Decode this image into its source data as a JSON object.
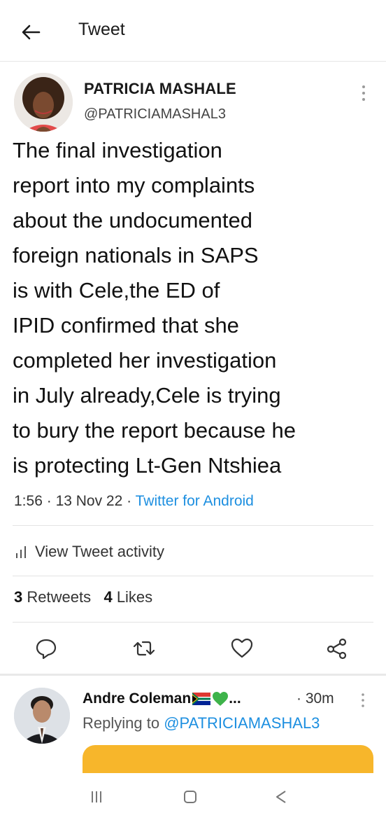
{
  "header": {
    "title": "Tweet",
    "back_icon": "arrow-left-icon"
  },
  "tweet": {
    "author_name": "PATRICIA MASHALE",
    "author_handle": "@PATRICIAMASHAL3",
    "lines": [
      "The final investigation",
      "report into my complaints",
      "about the undocumented",
      "foreign nationals in SAPS",
      "is with Cele,the ED of",
      "IPID confirmed that she",
      "completed her investigation",
      "in July already,Cele is trying",
      "to bury the report because he",
      "is protecting Lt-Gen Ntshiea"
    ],
    "time": "1:56",
    "date": "13 Nov 22",
    "separator": "·",
    "source": "Twitter for Android",
    "activity_label": "View Tweet activity",
    "retweets_count": "3",
    "retweets_label": "Retweets",
    "likes_count": "4",
    "likes_label": "Likes"
  },
  "actions": [
    "reply-icon",
    "retweet-icon",
    "like-icon",
    "share-icon"
  ],
  "reply": {
    "name": "Andre Coleman",
    "ellipsis": "...",
    "time": "· 30m",
    "replying_prefix": "Replying to ",
    "replying_to": "@PATRICIAMASHAL3",
    "card_color": "#f7b62b"
  },
  "colors": {
    "link": "#1d8fe0",
    "text": "#111111",
    "muted": "#555555"
  },
  "system_nav": [
    "recent-apps-icon",
    "home-icon",
    "back-triangle-icon"
  ]
}
